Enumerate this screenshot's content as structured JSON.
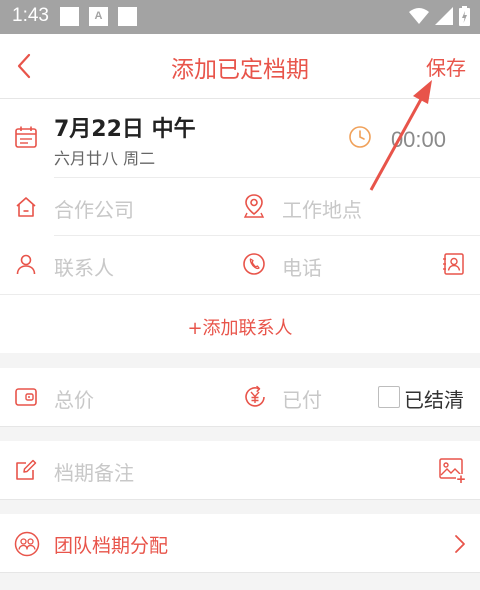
{
  "status": {
    "time": "1:43",
    "badge": "A"
  },
  "nav": {
    "title": "添加已定档期",
    "save_label": "保存"
  },
  "schedule": {
    "date": "7月22日 中午",
    "lunar": "六月廿八 周二",
    "time": "00:00"
  },
  "fields": {
    "company_placeholder": "合作公司",
    "location_placeholder": "工作地点",
    "contact_placeholder": "联系人",
    "phone_placeholder": "电话",
    "add_contact": "+添加联系人",
    "total_placeholder": "总价",
    "paid_placeholder": "已付",
    "settled_label": "已结清",
    "notes_placeholder": "档期备注",
    "team_label": "团队档期分配"
  },
  "colors": {
    "accent": "#e8544a",
    "placeholder": "#c8c8c8",
    "statusbar": "#a3a3a3"
  }
}
